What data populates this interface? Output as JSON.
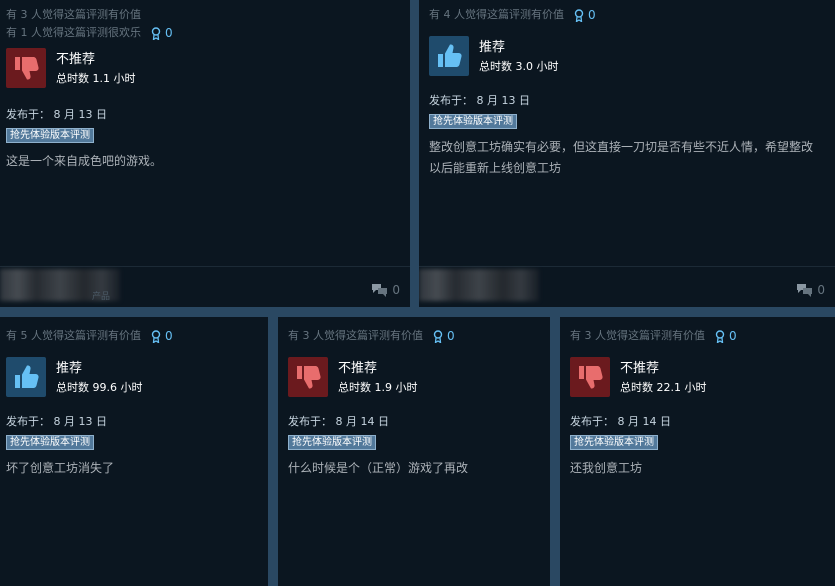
{
  "reviews": [
    {
      "helpful": "有 3 人觉得这篇评测有价值",
      "funny": "有 1 人觉得这篇评测很欢乐",
      "awards": "0",
      "verdict": "不推荐",
      "recommended": false,
      "hours": "总时数 1.1 小时",
      "posted": "发布于： 8 月 13 日",
      "badge": "抢先体验版本评测",
      "text": "这是一个来自成色吧的游戏。",
      "product_note": "产品",
      "comments": "0"
    },
    {
      "helpful": "有 4 人觉得这篇评测有价值",
      "awards": "0",
      "verdict": "推荐",
      "recommended": true,
      "hours": "总时数 3.0 小时",
      "posted": "发布于： 8 月 13 日",
      "badge": "抢先体验版本评测",
      "text": "整改创意工坊确实有必要，但这直接一刀切是否有些不近人情，希望整改以后能重新上线创意工坊",
      "comments": "0"
    },
    {
      "helpful": "有 5 人觉得这篇评测有价值",
      "awards": "0",
      "verdict": "推荐",
      "recommended": true,
      "hours": "总时数 99.6 小时",
      "posted": "发布于： 8 月 13 日",
      "badge": "抢先体验版本评测",
      "text": "坏了创意工坊消失了"
    },
    {
      "helpful": "有 3 人觉得这篇评测有价值",
      "awards": "0",
      "verdict": "不推荐",
      "recommended": false,
      "hours": "总时数 1.9 小时",
      "posted": "发布于： 8 月 14 日",
      "badge": "抢先体验版本评测",
      "text": "什么时候是个（正常）游戏了再改"
    },
    {
      "helpful": "有 3 人觉得这篇评测有价值",
      "awards": "0",
      "verdict": "不推荐",
      "recommended": false,
      "hours": "总时数 22.1 小时",
      "posted": "发布于： 8 月 14 日",
      "badge": "抢先体验版本评测",
      "text": "还我创意工坊"
    }
  ],
  "icons": {
    "award": "award-ribbon-icon",
    "thumbs_down": "thumbs-down-icon",
    "thumbs_up": "thumbs-up-icon",
    "comments": "comment-bubbles-icon"
  },
  "colors": {
    "card_bg": "#0b1620",
    "page_bg": "#2a4862",
    "accent": "#66c0f4",
    "negative_bg": "#6b1a1e",
    "positive_bg": "#1f4b6c",
    "badge_bg": "#52799b"
  }
}
